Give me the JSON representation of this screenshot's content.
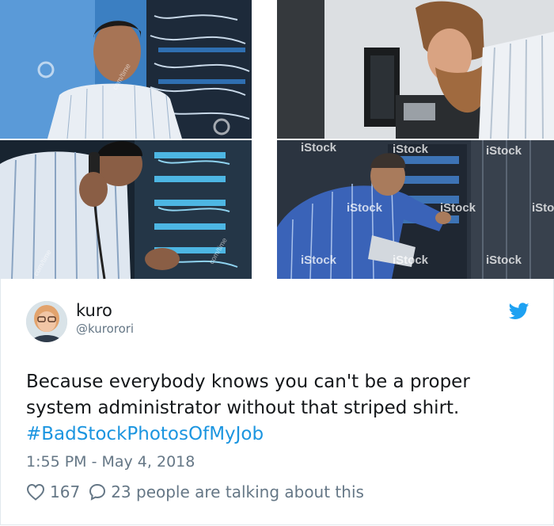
{
  "photos": {
    "watermarks": {
      "istock": "iStock",
      "side": "com/time"
    }
  },
  "tweet": {
    "name": "kuro",
    "handle": "@kurorori",
    "text": "Because everybody knows you can't be a proper system administrator without that striped shirt.",
    "hashtag": "#BadStockPhotosOfMyJob",
    "timestamp": "1:55 PM - May 4, 2018",
    "likes": "167",
    "talking": "23 people are talking about this"
  },
  "colors": {
    "link": "#1b95e0",
    "twitter_blue": "#1da1f2",
    "muted": "#657786"
  },
  "icons": [
    "twitter-bird-icon",
    "heart-icon",
    "comment-bubble-icon"
  ]
}
